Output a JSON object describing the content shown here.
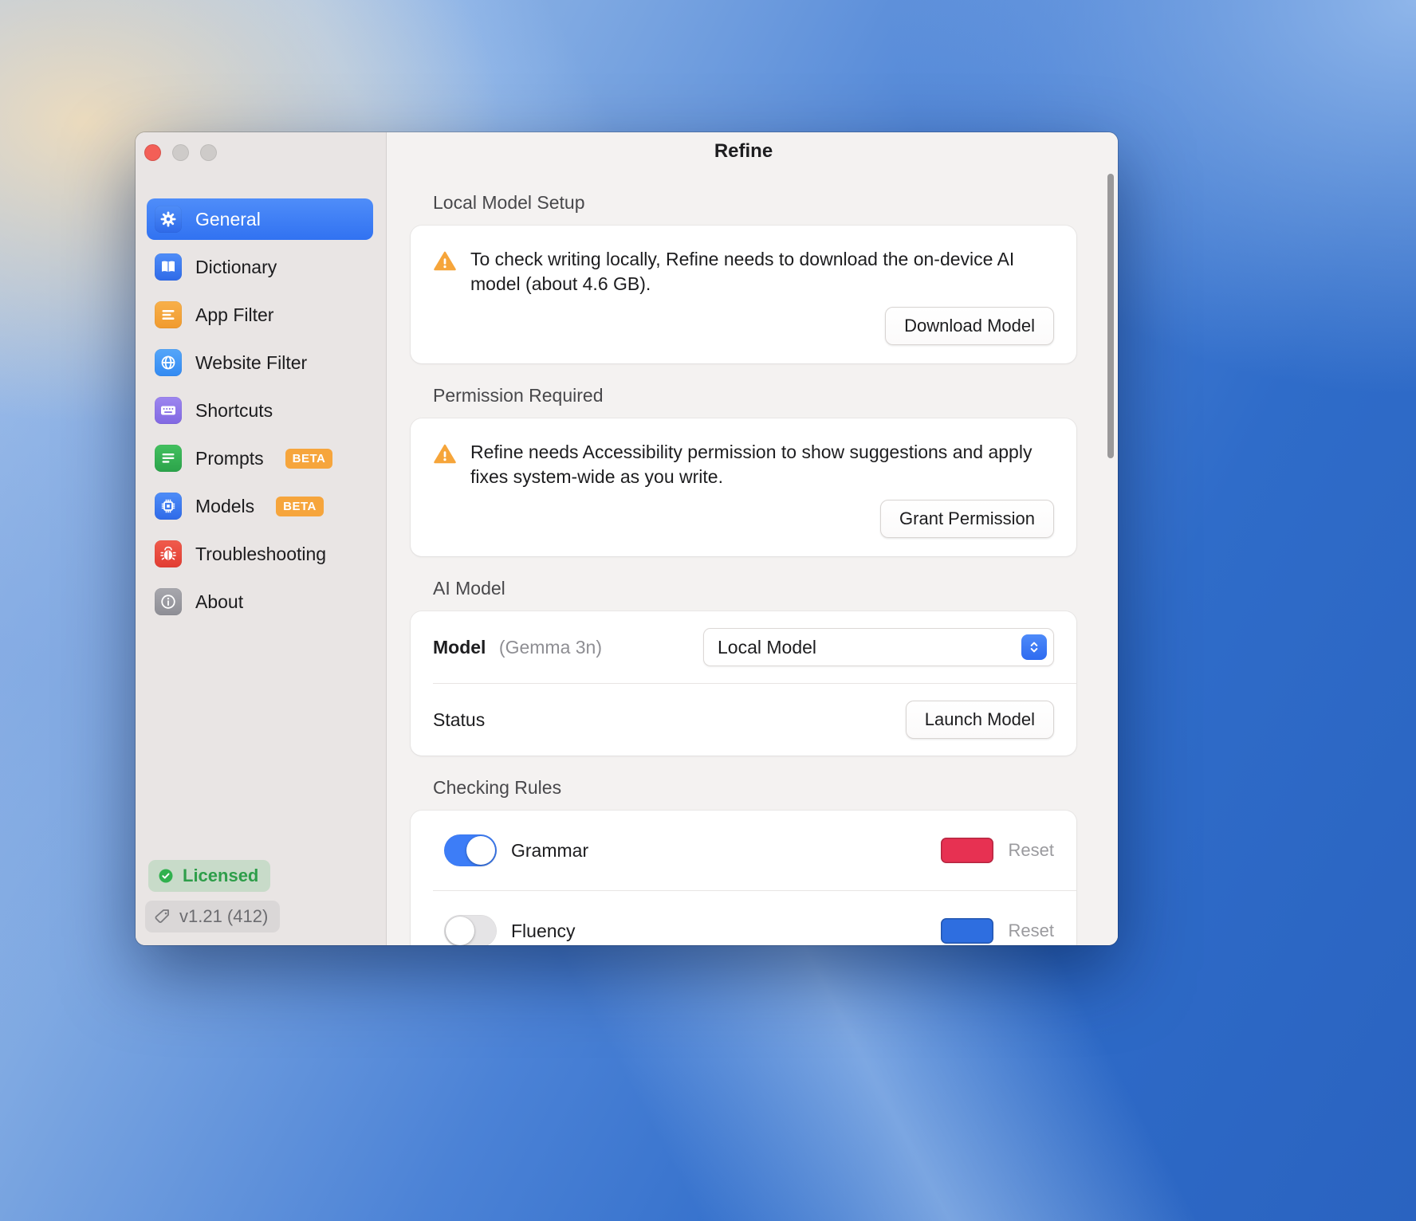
{
  "window": {
    "title": "Refine"
  },
  "sidebar": {
    "items": [
      {
        "label": "General",
        "selected": true
      },
      {
        "label": "Dictionary"
      },
      {
        "label": "App Filter"
      },
      {
        "label": "Website Filter"
      },
      {
        "label": "Shortcuts"
      },
      {
        "label": "Prompts",
        "badge": "BETA"
      },
      {
        "label": "Models",
        "badge": "BETA"
      },
      {
        "label": "Troubleshooting"
      },
      {
        "label": "About"
      }
    ],
    "footer": {
      "licensed_label": "Licensed",
      "version_label": "v1.21 (412)"
    }
  },
  "main": {
    "sections": {
      "local_model_setup": {
        "heading": "Local Model Setup",
        "warning_text": "To check writing locally, Refine needs to download the on-device AI model (about 4.6 GB).",
        "button_label": "Download Model"
      },
      "permission_required": {
        "heading": "Permission Required",
        "warning_text": "Refine needs Accessibility permission to show suggestions and apply fixes system-wide as you write.",
        "button_label": "Grant Permission"
      },
      "ai_model": {
        "heading": "AI Model",
        "model_label": "Model",
        "model_note": "(Gemma 3n)",
        "model_value": "Local Model",
        "status_label": "Status",
        "launch_button_label": "Launch Model"
      },
      "checking_rules": {
        "heading": "Checking Rules",
        "rules": [
          {
            "label": "Grammar",
            "enabled": true,
            "color": "#e73152",
            "reset_label": "Reset"
          },
          {
            "label": "Fluency",
            "enabled": false,
            "color": "#2e6ee0",
            "reset_label": "Reset"
          }
        ]
      }
    }
  },
  "colors": {
    "accent": "#3d7ef6",
    "beta_badge": "#f6a53c",
    "warning": "#f6a53a",
    "toggle_on": "#3d7df7",
    "licensed_green": "#2e9e4a"
  }
}
